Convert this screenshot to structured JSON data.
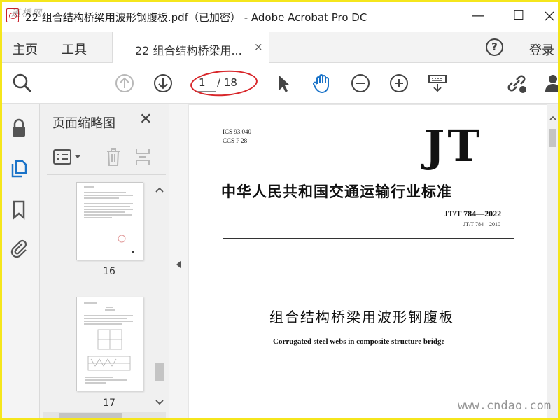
{
  "window": {
    "title": "22  组合结构桥梁用波形钢腹板.pdf（已加密） - Adobe Acrobat Pro DC",
    "minimize": "—",
    "maximize": "☐",
    "watermark": "道桥网"
  },
  "tabbar": {
    "home_label": "主页",
    "tools_label": "工具",
    "doc_tab_label": "22  组合结构桥梁用...",
    "doc_tab_close": "×",
    "help": "?",
    "login_label": "登录"
  },
  "toolbar": {
    "current_page": "1",
    "total_pages": "/ 18",
    "icons": [
      "search-icon",
      "prev-page-icon",
      "next-page-icon",
      "select-cursor-icon",
      "hand-tool-icon",
      "zoom-out-icon",
      "zoom-in-icon",
      "keyboard-icon",
      "share-link-icon",
      "user-icon"
    ],
    "accent_color": "#1a73c8",
    "annotation_color": "#d8262a"
  },
  "sidebar_rail": {
    "icons": [
      "lock-icon",
      "page-thumbnails-icon",
      "bookmark-icon",
      "attachment-icon"
    ]
  },
  "thumbnail_panel": {
    "title": "页面缩略图",
    "close": "✕",
    "thumbnails": [
      {
        "label": "16"
      },
      {
        "label": "17"
      }
    ]
  },
  "document": {
    "ics": "ICS 93.040",
    "ccs": "CCS  P 28",
    "logo": "JT",
    "standard_title": "中华人民共和国交通运输行业标准",
    "standard_code": "JT/T 784—2022",
    "replaces": "JT/T 784—2010",
    "title_cn": "组合结构桥梁用波形钢腹板",
    "title_en": "Corrugated steel webs in composite structure bridge"
  },
  "watermark_bottom": "www.cndao.com"
}
